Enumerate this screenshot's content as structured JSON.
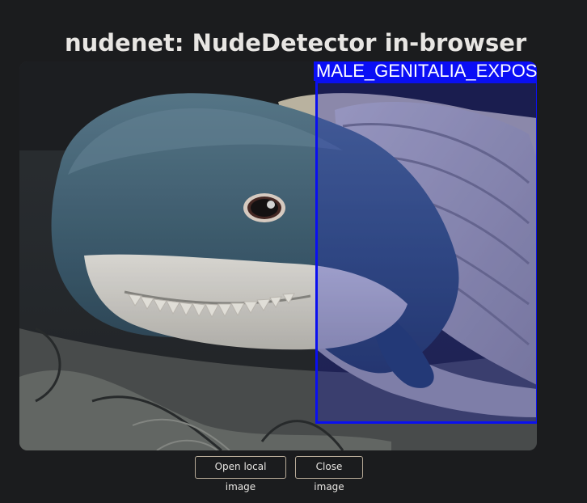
{
  "page": {
    "title": "nudenet: NudeDetector in-browser"
  },
  "image": {
    "subject": "plush shark toy under a blanket",
    "detection": {
      "label": "MALE_GENITALIA_EXPOSED",
      "box_color": "#0a10f0"
    }
  },
  "controls": {
    "open_label": "Open local image",
    "close_label": "Close image"
  },
  "colors": {
    "background": "#1b1c1e",
    "text": "#e8e6e3",
    "detection_blue": "#0a0ef5",
    "button_border": "#b8ab98"
  }
}
